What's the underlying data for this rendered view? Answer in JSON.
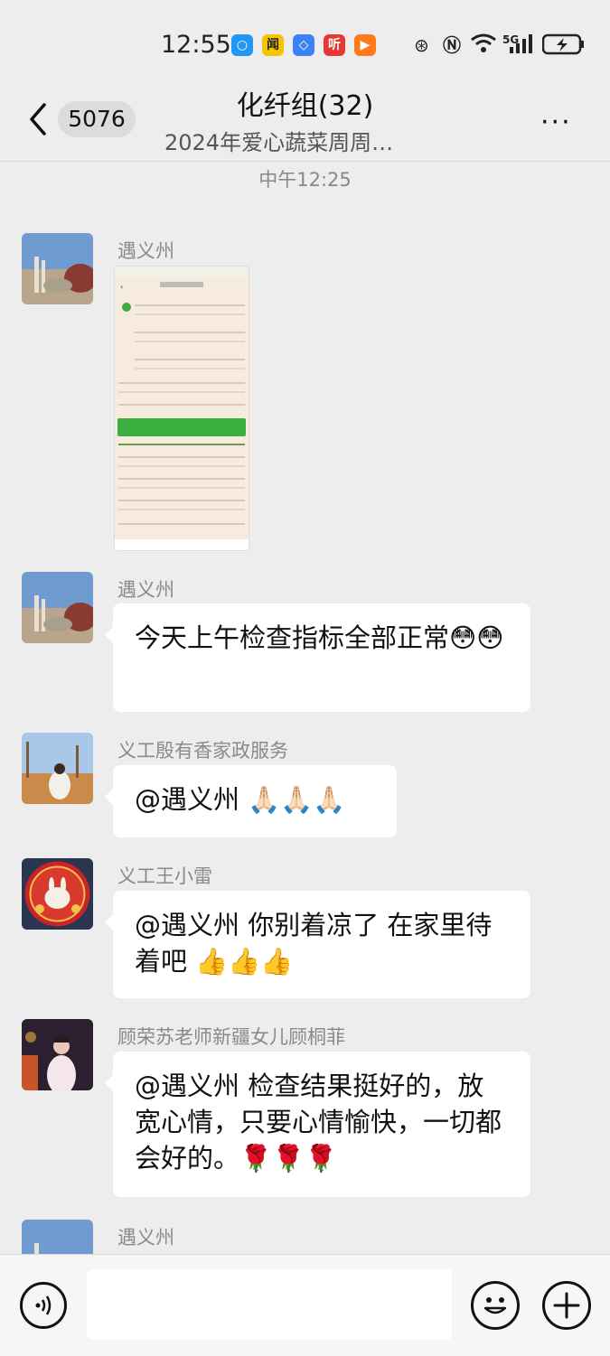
{
  "status_bar": {
    "time": "12:55",
    "network": "5G",
    "icons": [
      "qq-icon",
      "news-app-icon",
      "browser-icon",
      "listen-app-icon",
      "video-app-icon",
      "nfc-icon",
      "wifi-icon",
      "signal-icon",
      "battery-charging-icon"
    ]
  },
  "header": {
    "back_badge": "5076",
    "title": "化纤组(32)",
    "subtitle": "2024年爱心蔬菜周周…",
    "more_label": "···"
  },
  "chat": {
    "timestamp": "中午12:25",
    "messages": [
      {
        "sender": "遇义州",
        "type": "image"
      },
      {
        "sender": "遇义州",
        "text": "今天上午检查指标全部正常",
        "emoji": "😳😳"
      },
      {
        "sender": "义工殷有香家政服务",
        "text": "@遇义州  🙏🏻🙏🏻🙏🏻"
      },
      {
        "sender": "义工王小雷",
        "text": "@遇义州  你别着凉了  在家里待着吧  👍👍👍"
      },
      {
        "sender": "顾荣苏老师新疆女儿顾桐菲",
        "text": "@遇义州  检查结果挺好的，放宽心情，只要心情愉快，一切都会好的。🌹🌹🌹"
      },
      {
        "sender": "遇义州"
      }
    ]
  },
  "input_bar": {
    "voice_icon": "voice-icon",
    "emoji_icon": "emoji-icon",
    "plus_icon": "plus-icon"
  },
  "colors": {
    "background": "#ededed",
    "bubble": "#ffffff",
    "accent_green": "#3aae3e"
  }
}
